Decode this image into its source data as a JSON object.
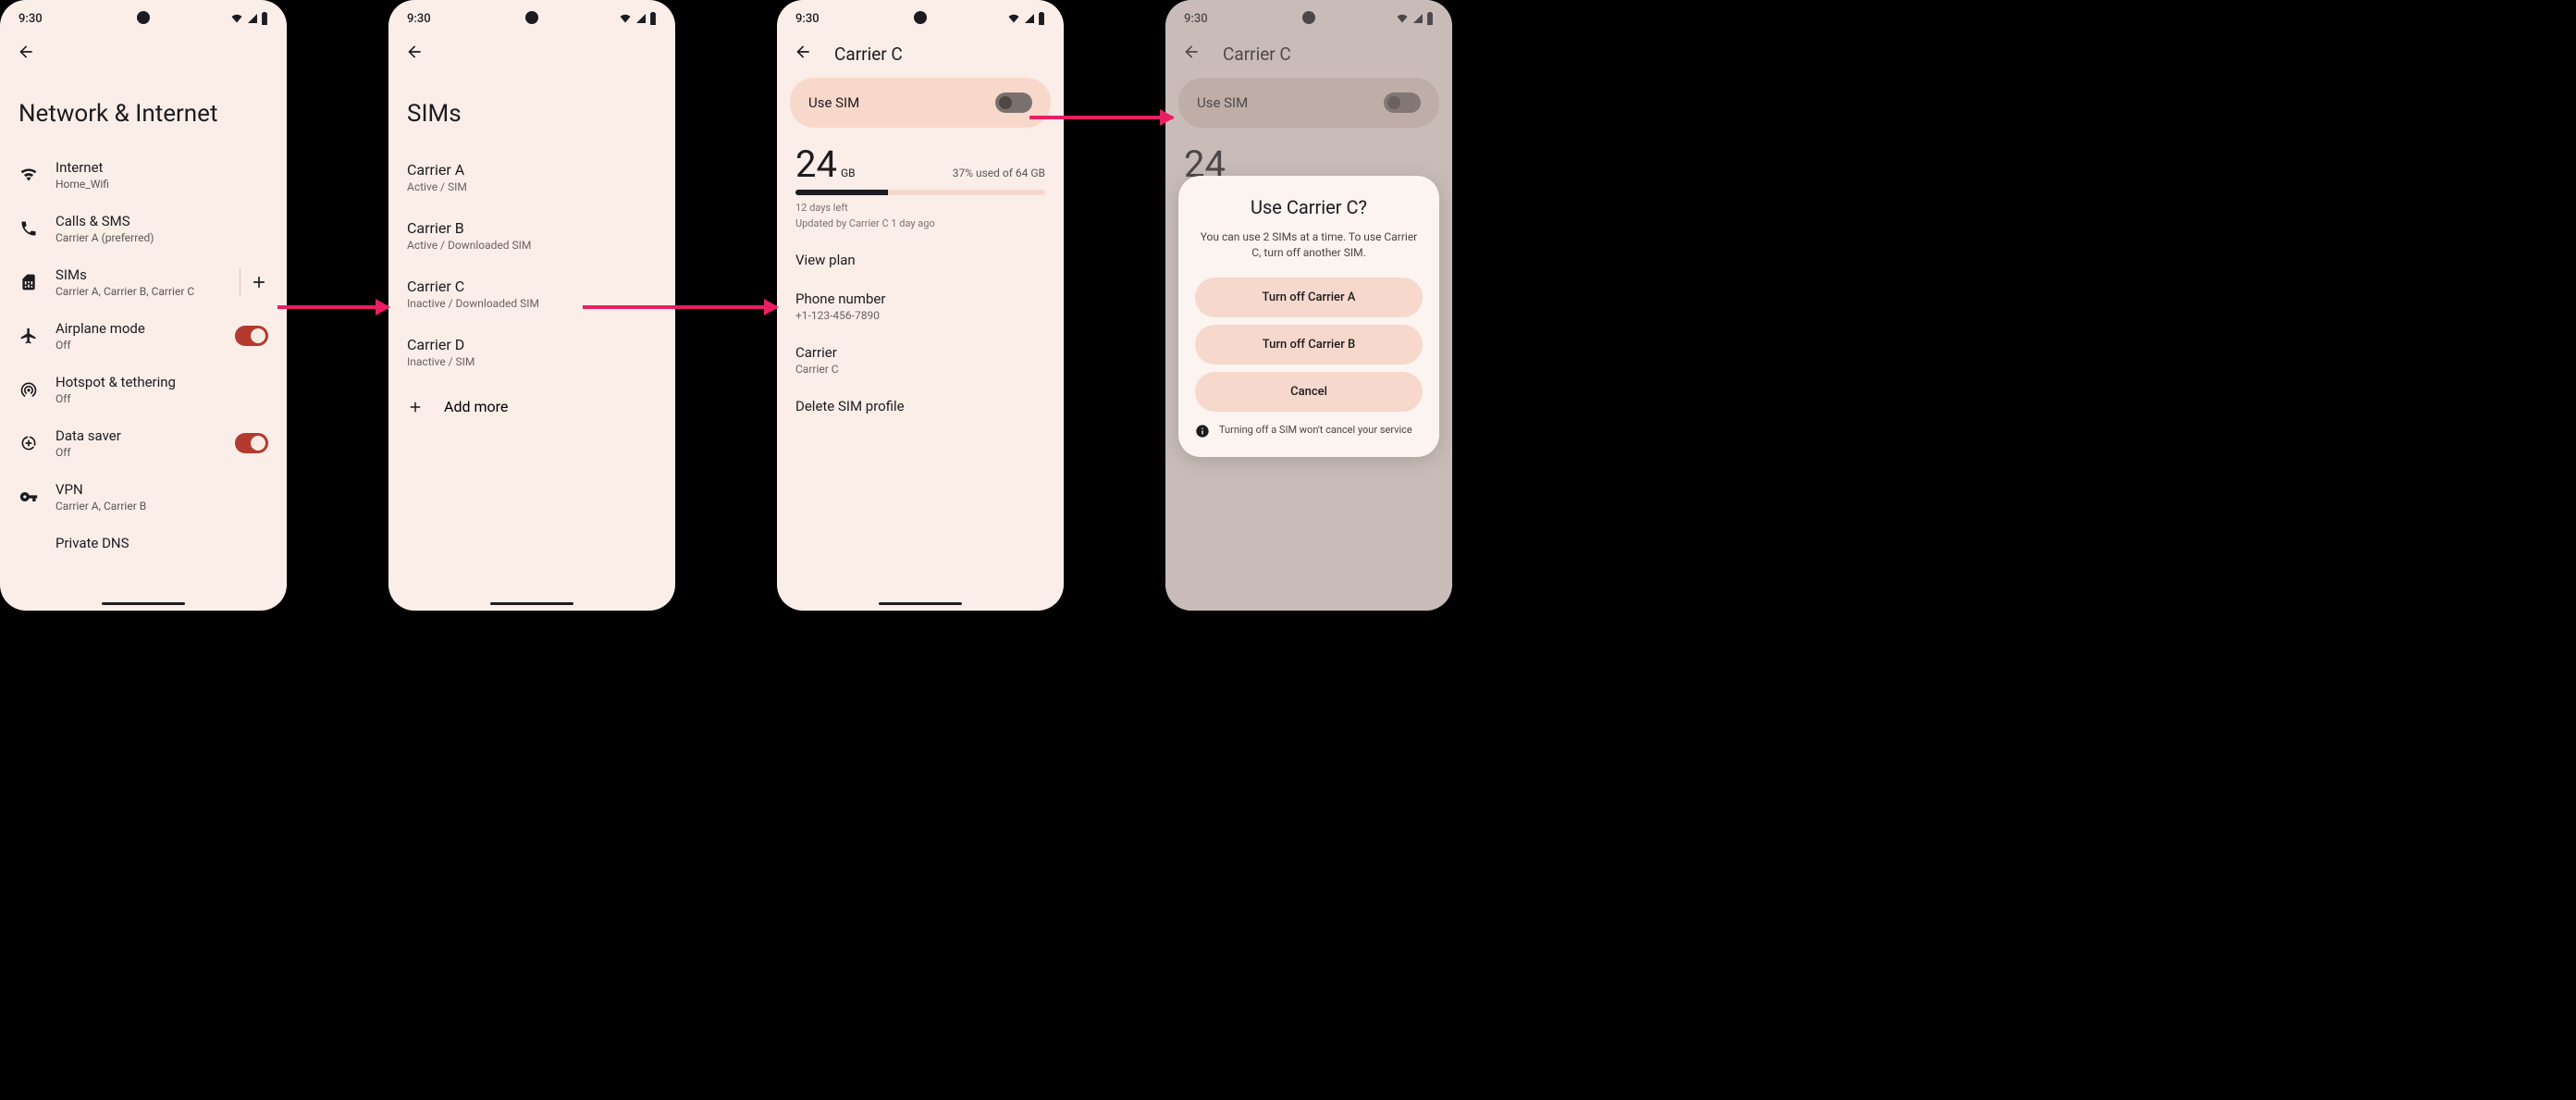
{
  "status": {
    "time": "9:30"
  },
  "screen1": {
    "title": "Network & Internet",
    "items": {
      "internet": {
        "title": "Internet",
        "sub": "Home_Wifi"
      },
      "calls": {
        "title": "Calls & SMS",
        "sub": "Carrier A (preferred)"
      },
      "sims": {
        "title": "SIMs",
        "sub": "Carrier A, Carrier B, Carrier C"
      },
      "airplane": {
        "title": "Airplane mode",
        "sub": "Off"
      },
      "hotspot": {
        "title": "Hotspot & tethering",
        "sub": "Off"
      },
      "datasaver": {
        "title": "Data saver",
        "sub": "Off"
      },
      "vpn": {
        "title": "VPN",
        "sub": "Carrier A, Carrier B"
      },
      "dns": {
        "title": "Private DNS"
      }
    }
  },
  "screen2": {
    "title": "SIMs",
    "sims": {
      "a": {
        "title": "Carrier A",
        "sub": "Active / SIM"
      },
      "b": {
        "title": "Carrier B",
        "sub": "Active / Downloaded SIM"
      },
      "c": {
        "title": "Carrier C",
        "sub": "Inactive / Downloaded SIM"
      },
      "d": {
        "title": "Carrier D",
        "sub": "Inactive / SIM"
      }
    },
    "add": "Add more"
  },
  "screen3": {
    "title": "Carrier C",
    "use_sim": "Use SIM",
    "data": {
      "amount": "24",
      "unit": "GB",
      "used": "37% used of 64 GB",
      "progress_pct": 37,
      "days": "12 days left",
      "updated": "Updated by Carrier C 1 day ago"
    },
    "rows": {
      "plan": {
        "title": "View plan"
      },
      "phone": {
        "title": "Phone number",
        "sub": "+1-123-456-7890"
      },
      "carrier": {
        "title": "Carrier",
        "sub": "Carrier C"
      },
      "delete": {
        "title": "Delete SIM profile"
      }
    }
  },
  "screen4": {
    "title": "Carrier C",
    "use_sim": "Use SIM",
    "dialog": {
      "title": "Use Carrier C?",
      "body": "You can use 2 SIMs at a time. To use Carrier C, turn off another SIM.",
      "btn_a": "Turn off Carrier A",
      "btn_b": "Turn off Carrier B",
      "cancel": "Cancel",
      "info": "Turning off a SIM won't cancel your service"
    }
  }
}
